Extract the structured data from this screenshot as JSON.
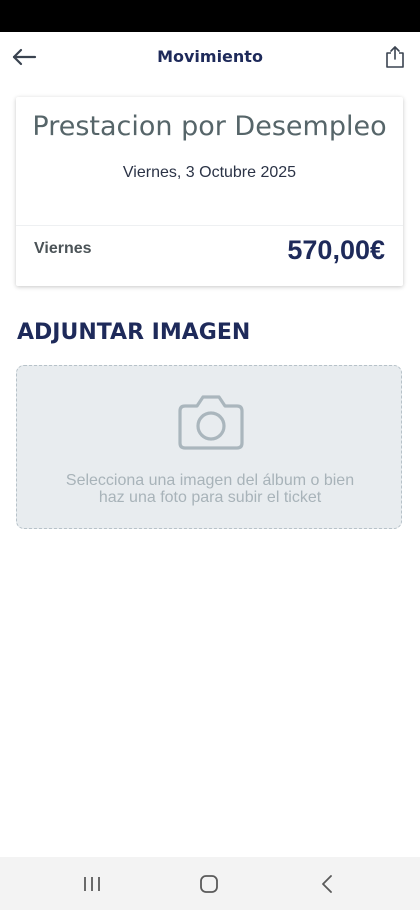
{
  "header": {
    "title": "Movimiento",
    "back_icon": "arrow-left-icon",
    "share_icon": "share-icon"
  },
  "card": {
    "title": "Prestacion por Desempleo",
    "date": "Viernes, 3 Octubre 2025",
    "day": "Viernes",
    "amount": "570,00€"
  },
  "attach": {
    "section_title": "ADJUNTAR IMAGEN",
    "camera_icon": "camera-icon",
    "hint_line1": "Selecciona una imagen del álbum o bien",
    "hint_line2": "haz una foto para subir el ticket"
  },
  "system_nav": {
    "recents_icon": "recents-icon",
    "home_icon": "home-icon",
    "back_icon": "back-chevron-icon"
  },
  "colors": {
    "brand_navy": "#1e2a5a",
    "title_gray": "#566569",
    "upload_bg": "#e8ecef",
    "hint_gray": "#a8b3b9"
  }
}
